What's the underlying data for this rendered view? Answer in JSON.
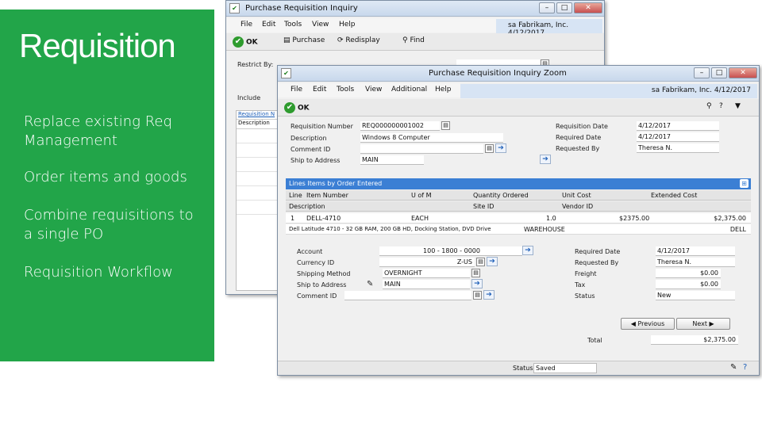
{
  "slide": {
    "title": "Requisition",
    "bullets": [
      "Replace existing Req\nManagement",
      "Order items and goods",
      "Combine requisitions to\na single PO",
      "Requisition Workflow"
    ]
  },
  "back_window": {
    "title": "Purchase Requisition Inquiry",
    "menu": [
      "File",
      "Edit",
      "Tools",
      "View",
      "Help"
    ],
    "user_info": "sa  Fabrikam, Inc.  4/12/2017",
    "toolbar": [
      "OK",
      "Purchase",
      "Redisplay",
      "Find"
    ],
    "restrict_label": "Restrict By:",
    "include_label": "Include",
    "grid_headers": [
      "Requisition N",
      "Description"
    ]
  },
  "front_window": {
    "title": "Purchase Requisition Inquiry Zoom",
    "menu": [
      "File",
      "Edit",
      "Tools",
      "View",
      "Additional",
      "Help"
    ],
    "user_info": "sa  Fabrikam, Inc.  4/12/2017",
    "ok_label": "OK",
    "header_fields": {
      "requisition_number_label": "Requisition Number",
      "requisition_number": "REQ000000001002",
      "description_label": "Description",
      "description": "Windows 8 Computer",
      "comment_id_label": "Comment ID",
      "comment_id": "",
      "ship_to_label": "Ship to Address",
      "ship_to": "MAIN",
      "req_date_label": "Requisition Date",
      "req_date": "4/12/2017",
      "required_date_label": "Required Date",
      "required_date": "4/12/2017",
      "requested_by_label": "Requested By",
      "requested_by": "Theresa N."
    },
    "lines_title": "Lines Items by Order Entered",
    "line_headers_1": [
      "Line",
      "Item Number",
      "U of M",
      "Quantity Ordered",
      "Unit Cost",
      "Extended Cost"
    ],
    "line_headers_2": [
      "Description",
      "Site ID",
      "Vendor ID"
    ],
    "line_row": {
      "line": "1",
      "item": "DELL-4710",
      "uom": "EACH",
      "qty": "1.0",
      "unit_cost": "$2375.00",
      "ext_cost": "$2,375.00",
      "description": "Dell Latitude 4710 - 32 GB RAM, 200 GB HD, Docking Station, DVD Drive",
      "site": "WAREHOUSE",
      "vendor": "DELL"
    },
    "detail": {
      "account_label": "Account",
      "account": "100 - 1800 - 0000",
      "currency_label": "Currency ID",
      "currency": "Z-US",
      "shipping_label": "Shipping Method",
      "shipping": "OVERNIGHT",
      "shipto_label": "Ship to Address",
      "shipto": "MAIN",
      "comment_label": "Comment ID",
      "comment": "",
      "req_date_label": "Required Date",
      "req_date": "4/12/2017",
      "requested_by_label": "Requested By",
      "requested_by": "Theresa N.",
      "freight_label": "Freight",
      "freight": "$0.00",
      "tax_label": "Tax",
      "tax": "$0.00",
      "status_label": "Status",
      "status": "New"
    },
    "prev_label": "Previous",
    "next_label": "Next",
    "total_label": "Total",
    "total": "$2,375.00",
    "status_bar_label": "Status",
    "status_bar_value": "Saved"
  }
}
